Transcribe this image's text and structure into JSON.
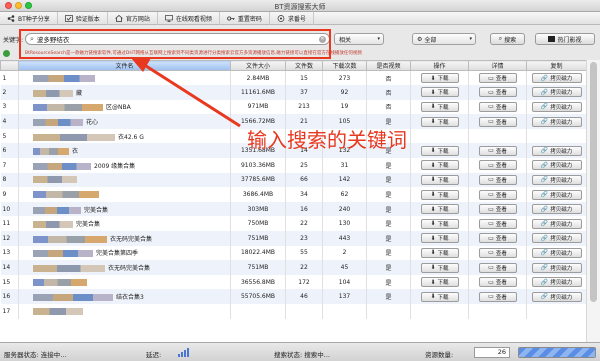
{
  "window": {
    "title": "BT资源搜索大师"
  },
  "nav": [
    {
      "label": "BT种子分享",
      "icon": "share-icon"
    },
    {
      "label": "验证版本",
      "icon": "verify-icon"
    },
    {
      "label": "官方网站",
      "icon": "home-icon"
    },
    {
      "label": "在线观看视频",
      "icon": "monitor-icon"
    },
    {
      "label": "重置密码",
      "icon": "key-icon"
    },
    {
      "label": "求番号",
      "icon": "request-icon"
    }
  ],
  "search": {
    "label": "关键字:",
    "query": "波多野结衣",
    "sort_select": "相关",
    "category_select": "全部",
    "search_button": "搜索",
    "hot_button": "热门影视"
  },
  "notice": "BtResourceSearch是一款磁力链搜索软件,可通过DHT网络从互联网上搜索到不同类资源进行分类搜索云官方多资源播放信息,磁力链接可以直接在官方在线播放任何视频",
  "table": {
    "columns": [
      "文件名",
      "文件大小",
      "文件数",
      "下载次数",
      "是否视频",
      "操作",
      "详情",
      "复制"
    ],
    "download_label": "下载",
    "details_label": "查看",
    "copy_label": "拷贝磁力",
    "rows": [
      {
        "idx": "1",
        "name": "",
        "size": "2.84MB",
        "files": "15",
        "downloads": "273",
        "video": "否"
      },
      {
        "idx": "2",
        "name": "藏",
        "size": "11161.6MB",
        "files": "37",
        "downloads": "92",
        "video": "否"
      },
      {
        "idx": "3",
        "name": "区@NBA",
        "size": "971MB",
        "files": "213",
        "downloads": "19",
        "video": "否"
      },
      {
        "idx": "4",
        "name": "花心",
        "size": "1566.72MB",
        "files": "21",
        "downloads": "105",
        "video": "是"
      },
      {
        "idx": "5",
        "name": "衣42.6 G",
        "size": "",
        "files": "",
        "downloads": "",
        "video": ""
      },
      {
        "idx": "6",
        "name": "衣",
        "size": "1351.68MB",
        "files": "14",
        "downloads": "132",
        "video": "是"
      },
      {
        "idx": "7",
        "name": "2009 缘集合集",
        "size": "9103.36MB",
        "files": "25",
        "downloads": "31",
        "video": "是"
      },
      {
        "idx": "8",
        "name": "",
        "size": "37785.6MB",
        "files": "66",
        "downloads": "142",
        "video": "是"
      },
      {
        "idx": "9",
        "name": "",
        "size": "3686.4MB",
        "files": "34",
        "downloads": "62",
        "video": "是"
      },
      {
        "idx": "10",
        "name": "完美合集",
        "size": "303MB",
        "files": "16",
        "downloads": "240",
        "video": "是"
      },
      {
        "idx": "11",
        "name": "完美合集",
        "size": "750MB",
        "files": "22",
        "downloads": "130",
        "video": "是"
      },
      {
        "idx": "12",
        "name": "衣无码完美合集",
        "size": "751MB",
        "files": "23",
        "downloads": "443",
        "video": "是"
      },
      {
        "idx": "13",
        "name": "完美合集第四季",
        "size": "18022.4MB",
        "files": "55",
        "downloads": "2",
        "video": "是"
      },
      {
        "idx": "14",
        "name": "衣无码完美合集",
        "size": "751MB",
        "files": "22",
        "downloads": "45",
        "video": "是"
      },
      {
        "idx": "15",
        "name": "",
        "size": "36556.8MB",
        "files": "172",
        "downloads": "104",
        "video": "是"
      },
      {
        "idx": "16",
        "name": "结衣合集3",
        "size": "55705.6MB",
        "files": "46",
        "downloads": "137",
        "video": "是"
      },
      {
        "idx": "17",
        "name": "",
        "size": "",
        "files": "",
        "downloads": "",
        "video": ""
      }
    ]
  },
  "annotation": {
    "text": "输入搜索的关键词",
    "color": "#e8381f"
  },
  "status": {
    "server_label": "服务器状态: 连接中...",
    "latency_label": "延迟:",
    "search_label": "搜索状态: 搜索中...",
    "count_label": "资源数量:",
    "count_value": "26"
  }
}
